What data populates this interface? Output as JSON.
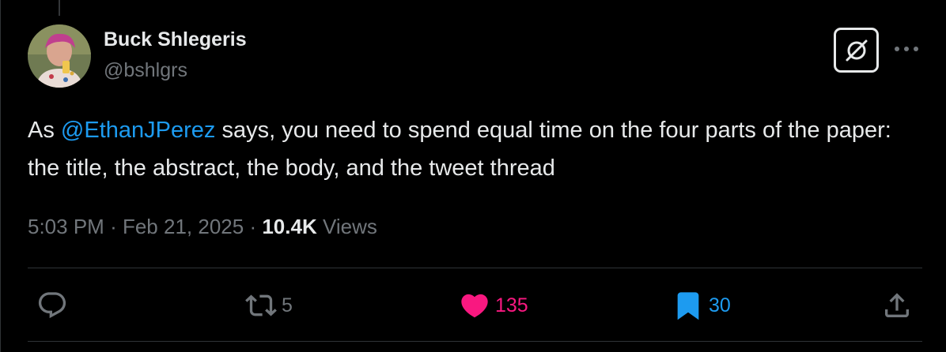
{
  "author": {
    "name": "Buck Shlegeris",
    "handle": "@bshlgrs"
  },
  "tweet": {
    "text_before": "As ",
    "mention": "@EthanJPerez",
    "text_after": " says, you need to spend equal time on the four parts of the paper: the title, the abstract, the body, and the tweet thread"
  },
  "meta": {
    "time": "5:03 PM",
    "separator": "·",
    "date": "Feb 21, 2025",
    "views_count": "10.4K",
    "views_label": "Views"
  },
  "actions": {
    "reply_icon": "reply-icon",
    "retweet_icon": "retweet-icon",
    "retweet_count": "5",
    "like_icon": "heart-icon",
    "like_count": "135",
    "bookmark_icon": "bookmark-icon",
    "bookmark_count": "30",
    "share_icon": "share-icon"
  },
  "colors": {
    "background": "#000000",
    "text": "#e7e9ea",
    "secondary": "#71767b",
    "link": "#1d9bf0",
    "like": "#f91880",
    "bookmark": "#1d9bf0",
    "divider": "#2f3336"
  }
}
